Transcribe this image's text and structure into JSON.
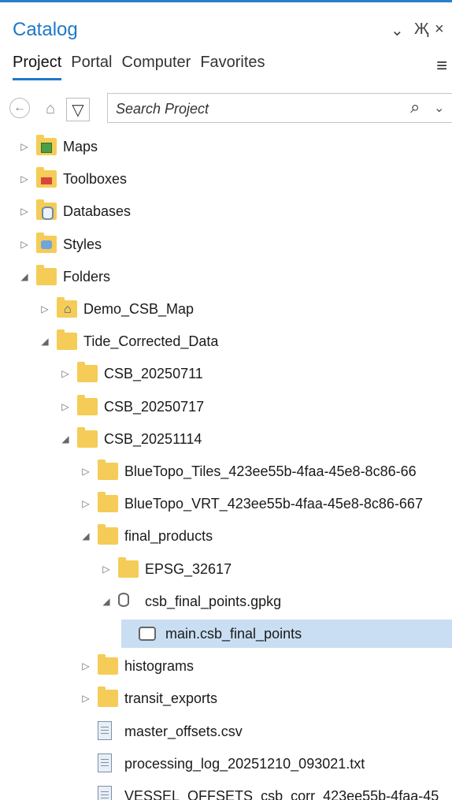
{
  "panel": {
    "title": "Catalog",
    "window_buttons": {
      "dropdown": "⌄",
      "pin": "Җ",
      "close": "×"
    }
  },
  "tabs": [
    {
      "label": "Project",
      "active": true
    },
    {
      "label": "Portal",
      "active": false
    },
    {
      "label": "Computer",
      "active": false
    },
    {
      "label": "Favorites",
      "active": false
    }
  ],
  "menu_icon": "≡",
  "toolbar": {
    "back_icon": "←",
    "home_icon": "⌂",
    "filter_icon": "▽",
    "search_placeholder": "Search Project",
    "search_icon": "⌕",
    "dropdown_icon": "⌄"
  },
  "tree": [
    {
      "label": "Maps",
      "icon": "maps-icon",
      "expanded": false,
      "level": 0
    },
    {
      "label": "Toolboxes",
      "icon": "toolbox-icon",
      "expanded": false,
      "level": 0
    },
    {
      "label": "Databases",
      "icon": "database-icon",
      "expanded": false,
      "level": 0
    },
    {
      "label": "Styles",
      "icon": "styles-icon",
      "expanded": false,
      "level": 0
    },
    {
      "label": "Folders",
      "icon": "folder-icon",
      "expanded": true,
      "level": 0
    },
    {
      "label": "Demo_CSB_Map",
      "icon": "home-folder-icon",
      "expanded": false,
      "level": 1
    },
    {
      "label": "Tide_Corrected_Data",
      "icon": "folder-icon",
      "expanded": true,
      "level": 1
    },
    {
      "label": "CSB_20250711",
      "icon": "folder-icon",
      "expanded": false,
      "level": 2
    },
    {
      "label": "CSB_20250717",
      "icon": "folder-icon",
      "expanded": false,
      "level": 2
    },
    {
      "label": "CSB_20251114",
      "icon": "folder-icon",
      "expanded": true,
      "level": 2
    },
    {
      "label": "BlueTopo_Tiles_423ee55b-4faa-45e8-8c86-66",
      "icon": "folder-icon",
      "expanded": false,
      "level": 3
    },
    {
      "label": "BlueTopo_VRT_423ee55b-4faa-45e8-8c86-667",
      "icon": "folder-icon",
      "expanded": false,
      "level": 3
    },
    {
      "label": "final_products",
      "icon": "folder-icon",
      "expanded": true,
      "level": 3
    },
    {
      "label": "EPSG_32617",
      "icon": "folder-icon",
      "expanded": false,
      "level": 4
    },
    {
      "label": "csb_final_points.gpkg",
      "icon": "geopackage-icon",
      "expanded": true,
      "level": 4
    },
    {
      "label": "main.csb_final_points",
      "icon": "table-icon",
      "expanded": null,
      "level": 5,
      "selected": true
    },
    {
      "label": "histograms",
      "icon": "folder-icon",
      "expanded": false,
      "level": 3
    },
    {
      "label": "transit_exports",
      "icon": "folder-icon",
      "expanded": false,
      "level": 3
    },
    {
      "label": "master_offsets.csv",
      "icon": "file-icon",
      "expanded": null,
      "level": 3
    },
    {
      "label": "processing_log_20251210_093021.txt",
      "icon": "file-icon",
      "expanded": null,
      "level": 3
    },
    {
      "label": "VESSEL_OFFSETS_csb_corr_423ee55b-4faa-45",
      "icon": "file-icon",
      "expanded": null,
      "level": 3
    }
  ],
  "colors": {
    "accent": "#1f78c8",
    "selection": "#c9def2",
    "folder": "#f4cc57"
  }
}
